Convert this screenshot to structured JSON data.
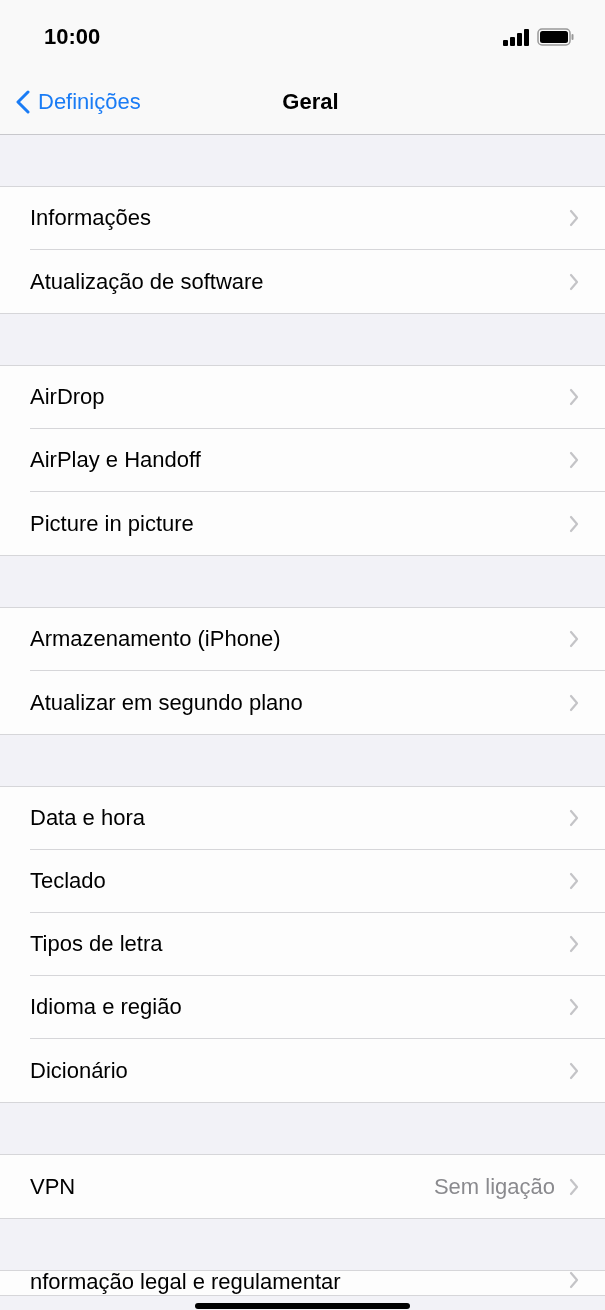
{
  "status_bar": {
    "time": "10:00"
  },
  "nav_bar": {
    "back": "Definições",
    "title": "Geral"
  },
  "groups": [
    {
      "items": [
        {
          "label": "Informações"
        },
        {
          "label": "Atualização de software"
        }
      ]
    },
    {
      "items": [
        {
          "label": "AirDrop"
        },
        {
          "label": "AirPlay e Handoff"
        },
        {
          "label": "Picture in picture"
        }
      ]
    },
    {
      "items": [
        {
          "label": "Armazenamento (iPhone)"
        },
        {
          "label": "Atualizar em segundo plano"
        }
      ]
    },
    {
      "items": [
        {
          "label": "Data e hora"
        },
        {
          "label": "Teclado"
        },
        {
          "label": "Tipos de letra"
        },
        {
          "label": "Idioma e região"
        },
        {
          "label": "Dicionário"
        }
      ]
    },
    {
      "items": [
        {
          "label": "VPN",
          "value": "Sem ligação"
        }
      ]
    },
    {
      "items": [
        {
          "label": "nformação legal e regulamentar"
        }
      ]
    }
  ]
}
